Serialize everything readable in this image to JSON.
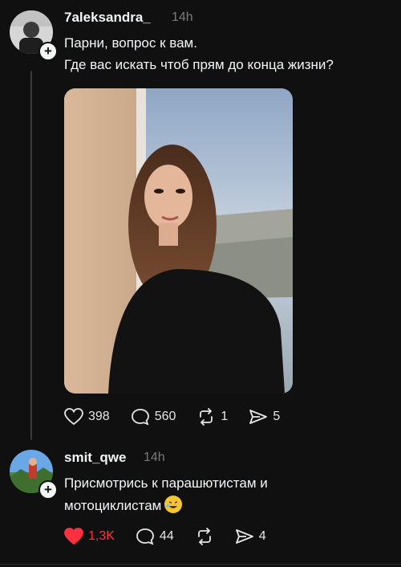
{
  "post1": {
    "username": "7aleksandra_",
    "time": "14h",
    "text_line1": "Парни, вопрос к вам.",
    "text_line2": "Где вас искать чтоб прям до конца жизни?",
    "likes": "398",
    "comments": "560",
    "reposts": "1",
    "shares": "5"
  },
  "post2": {
    "username": "smit_qwe",
    "time": "14h",
    "text_line1": "Присмотрись к парашютистам и",
    "text_line2": "мотоциклистам",
    "likes": "1,3K",
    "comments": "44",
    "shares": "4",
    "liked": true
  },
  "colors": {
    "background": "#101010",
    "text": "#f3f5f7",
    "muted": "#7a7a7a",
    "like_active": "#ff3040"
  },
  "icons": [
    "heart-icon",
    "comment-icon",
    "repost-icon",
    "share-icon",
    "plus-icon",
    "emoji-icon"
  ]
}
